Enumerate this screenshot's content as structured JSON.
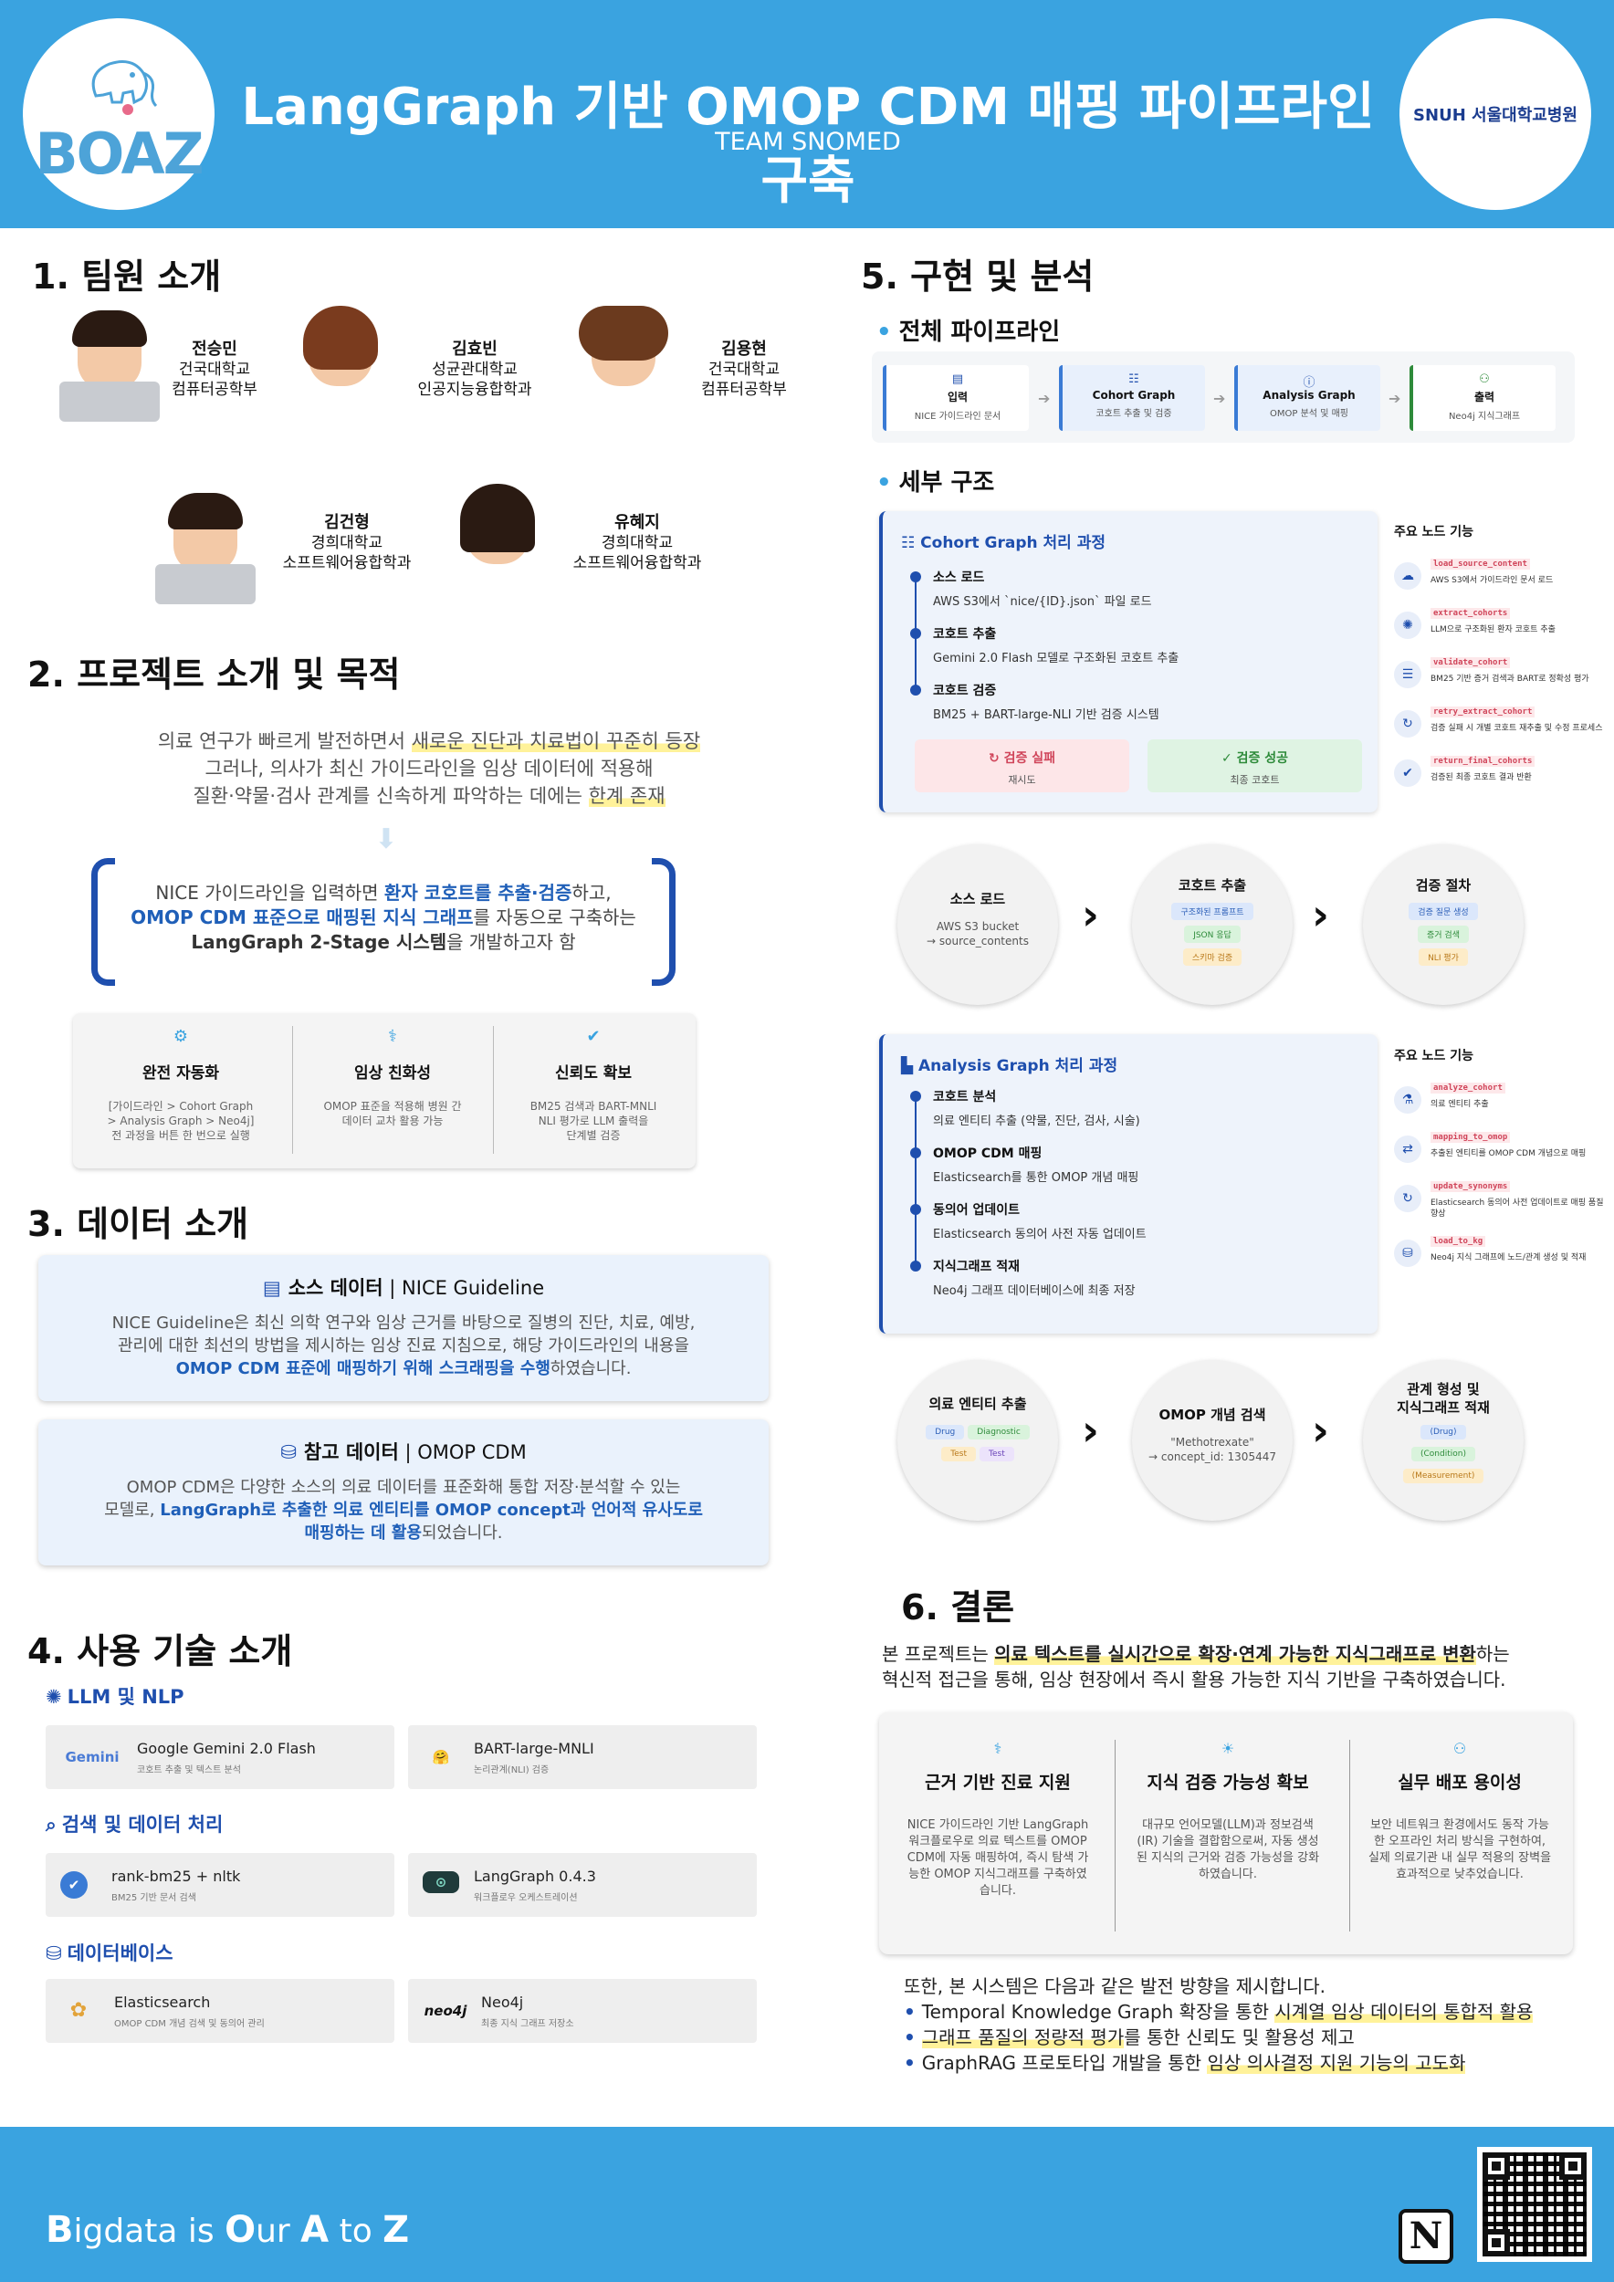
{
  "header": {
    "title": "LangGraph 기반 OMOP CDM 매핑 파이프라인 구축",
    "subtitle": "TEAM SNOMED",
    "logo_left": "BOAZ",
    "logo_right": "SNUH 서울대학교병원"
  },
  "footer": {
    "slogan_b": "B",
    "slogan_1": "igdata is ",
    "slogan_o": "O",
    "slogan_2": "ur ",
    "slogan_a": "A",
    "slogan_3": " to ",
    "slogan_z": "Z",
    "notion_letter": "N"
  },
  "team": {
    "heading": "1. 팀원 소개",
    "members": [
      {
        "name": "전승민",
        "school": "건국대학교",
        "dept": "컴퓨터공학부"
      },
      {
        "name": "김효빈",
        "school": "성균관대학교",
        "dept": "인공지능융합학과"
      },
      {
        "name": "김용현",
        "school": "건국대학교",
        "dept": "컴퓨터공학부"
      },
      {
        "name": "김건형",
        "school": "경희대학교",
        "dept": "소프트웨어융합학과"
      },
      {
        "name": "유혜지",
        "school": "경희대학교",
        "dept": "소프트웨어융합학과"
      }
    ]
  },
  "project": {
    "heading": "2. 프로젝트 소개 및 목적",
    "line1_a": "의료 연구가 빠르게 발전하면서 ",
    "line1_hl": "새로운 진단과 치료법이 꾸준히 등장",
    "line2": "그러나, 의사가 최신 가이드라인을 임상 데이터에 적용해",
    "line3_a": "질환·약물·검사 관계를 신속하게 파악하는 데에는 ",
    "line3_hl": "한계 존재",
    "goal_a": "NICE 가이드라인을 입력하면 ",
    "goal_b": "환자 코호트를 추출·검증",
    "goal_c": "하고,",
    "goal_d": "OMOP CDM 표준으로 매핑된 지식 그래프",
    "goal_e": "를 자동으로 구축하는",
    "goal_f": "LangGraph 2-Stage 시스템",
    "goal_g": "을 개발하고자 함",
    "features": [
      {
        "title": "완전 자동화",
        "desc1": "[가이드라인 > Cohort Graph",
        "desc2": "> Analysis Graph > Neo4j]",
        "desc3": "전 과정을 버튼 한 번으로 실행"
      },
      {
        "title": "임상 친화성",
        "desc1": "OMOP 표준을 적용해 병원 간",
        "desc2": "데이터 교차 활용 가능",
        "desc3": ""
      },
      {
        "title": "신뢰도 확보",
        "desc1": "BM25 검색과 BART-MNLI",
        "desc2": "NLI 평가로 LLM 출력을",
        "desc3": "단계별 검증"
      }
    ]
  },
  "data": {
    "heading": "3. 데이터 소개",
    "source_title": "소스 데이터",
    "source_sub": " | NICE Guideline",
    "source_text1": "NICE Guideline은 최신 의학 연구와 임상 근거를 바탕으로 질병의 진단, 치료, 예방,",
    "source_text2": "관리에 대한 최선의 방법을 제시하는 임상 진료 지침으로, 해당 가이드라인의 내용을",
    "source_text3_b": "OMOP CDM 표준에 매핑하기 위해 스크래핑을 수행",
    "source_text3_c": "하였습니다.",
    "ref_title": "참고 데이터",
    "ref_sub": " | OMOP CDM",
    "ref_text1": "OMOP CDM은 다양한 소스의 의료 데이터를 표준화해 통합 저장·분석할 수 있는",
    "ref_text2_a": "모델로, ",
    "ref_text2_b": "LangGraph로 추출한 의료 엔티티를 OMOP concept과 언어적 유사도로",
    "ref_text3_b": "매핑하는 데 활용",
    "ref_text3_c": "되었습니다."
  },
  "tech": {
    "heading": "4. 사용 기술 소개",
    "groups": [
      {
        "title": "LLM 및 NLP",
        "items": [
          {
            "logo": "Gemini",
            "name": "Google Gemini 2.0 Flash",
            "desc": "코호트 추출 및 텍스트 분석"
          },
          {
            "logo": "🤗",
            "name": "BART-large-MNLI",
            "desc": "논리관계(NLI) 검증"
          }
        ]
      },
      {
        "title": "검색 및 데이터 처리",
        "items": [
          {
            "logo": "✔",
            "name": "rank-bm25 + nltk",
            "desc": "BM25 기반 문서 검색"
          },
          {
            "logo": "⊙",
            "name": "LangGraph 0.4.3",
            "desc": "워크플로우 오케스트레이션"
          }
        ]
      },
      {
        "title": "데이터베이스",
        "items": [
          {
            "logo": "✿",
            "name": "Elasticsearch",
            "desc": "OMOP CDM 개념 검색 및 동의어 관리"
          },
          {
            "logo": "neo4j",
            "name": "Neo4j",
            "desc": "최종 지식 그래프 저장소"
          }
        ]
      }
    ]
  },
  "impl": {
    "heading": "5. 구현 및 분석",
    "pipeline_heading": "전체 파이프라인",
    "pipeline": [
      {
        "title": "입력",
        "desc": "NICE 가이드라인 문서"
      },
      {
        "title": "Cohort Graph",
        "desc": "코호트 추출 및 검증"
      },
      {
        "title": "Analysis Graph",
        "desc": "OMOP 분석 및 매핑"
      },
      {
        "title": "출력",
        "desc": "Neo4j 지식그래프"
      }
    ],
    "detail_heading": "세부 구조",
    "cohort": {
      "title": "Cohort Graph 처리 과정",
      "steps": [
        {
          "title": "소스 로드",
          "desc": "AWS S3에서 `nice/{ID}.json` 파일 로드"
        },
        {
          "title": "코호트 추출",
          "desc": "Gemini 2.0 Flash 모델로 구조화된 코호트 추출"
        },
        {
          "title": "코호트 검증",
          "desc": "BM25 + BART-large-NLI 기반 검증 시스템"
        }
      ],
      "fail_title": "검증 실패",
      "fail_desc": "재시도",
      "success_title": "검증 성공",
      "success_desc": "최종 코호트"
    },
    "cohort_nodes_heading": "주요 노드 기능",
    "cohort_nodes": [
      {
        "code": "load_source_content",
        "desc": "AWS S3에서 가이드라인 문서 로드"
      },
      {
        "code": "extract_cohorts",
        "desc": "LLM으로 구조화된 환자 코호트 추출"
      },
      {
        "code": "validate_cohort",
        "desc": "BM25 기반 증거 검색과 BART로 정확성 평가"
      },
      {
        "code": "retry_extract_cohort",
        "desc": "검증 실패 시 개별 코호트 재추출 및 수정 프로세스"
      },
      {
        "code": "return_final_cohorts",
        "desc": "검증된 최종 코호트 결과 반환"
      }
    ],
    "cohort_circles": [
      {
        "title": "소스 로드",
        "desc1": "AWS S3 bucket",
        "desc2": "→ source_contents"
      },
      {
        "title": "코호트 추출",
        "pills": [
          "구조화된 프롬프트",
          "JSON 응답",
          "스키마 검증"
        ]
      },
      {
        "title": "검증 절차",
        "pills": [
          "검증 질문 생성",
          "증거 검색",
          "NLI 평가"
        ]
      }
    ],
    "analysis": {
      "title": "Analysis Graph 처리 과정",
      "steps": [
        {
          "title": "코호트 분석",
          "desc": "의료 엔티티 추출 (약물, 진단, 검사, 시술)"
        },
        {
          "title": "OMOP CDM 매핑",
          "desc": "Elasticsearch를 통한 OMOP 개념 매핑"
        },
        {
          "title": "동의어 업데이트",
          "desc": "Elasticsearch 동의어 사전 자동 업데이트"
        },
        {
          "title": "지식그래프 적재",
          "desc": "Neo4j 그래프 데이터베이스에 최종 저장"
        }
      ]
    },
    "analysis_nodes_heading": "주요 노드 기능",
    "analysis_nodes": [
      {
        "code": "analyze_cohort",
        "desc": "의료 엔티티 추출"
      },
      {
        "code": "mapping_to_omop",
        "desc": "추출된 엔티티를 OMOP CDM 개념으로 매핑"
      },
      {
        "code": "update_synonyms",
        "desc": "Elasticsearch 동의어 사전 업데이트로 매핑 품질 향상"
      },
      {
        "code": "load_to_kg",
        "desc": "Neo4j 지식 그래프에 노드/관계 생성 및 적재"
      }
    ],
    "analysis_circles": [
      {
        "title": "의료 엔티티 추출",
        "pills": [
          "Drug",
          "Diagnostic",
          "Test",
          "Test"
        ]
      },
      {
        "title": "OMOP 개념 검색",
        "desc1": "\"Methotrexate\"",
        "desc2": "→ concept_id: 1305447"
      },
      {
        "title1": "관계 형성 및",
        "title2": "지식그래프 적재",
        "pills": [
          "(Drug)",
          "(Condition)",
          "(Measurement)"
        ]
      }
    ]
  },
  "conclusion": {
    "heading": "6. 결론",
    "intro_a": "본 프로젝트는 ",
    "intro_b": "의료 텍스트를 실시간으로 확장·연계 가능한 지식그래프로 변환",
    "intro_c": "하는",
    "intro_d": "혁신적 접근을 통해, 임상 현장에서 즉시 활용 가능한 지식 기반을 구축하였습니다.",
    "cards": [
      {
        "title": "근거 기반 진료 지원",
        "desc": "NICE 가이드라인 기반 LangGraph 워크플로우로 의료 텍스트를 OMOP CDM에 자동 매핑하여, 즉시 탐색 가능한 OMOP 지식그래프를 구축하였습니다."
      },
      {
        "title": "지식 검증 가능성 확보",
        "desc": "대규모 언어모델(LLM)과 정보검색(IR) 기술을 결합함으로써, 자동 생성된 지식의 근거와 검증 가능성을 강화하였습니다."
      },
      {
        "title": "실무 배포 용이성",
        "desc": "보안 네트워크 환경에서도 동작 가능한 오프라인 처리 방식을 구현하여, 실제 의료기관 내 실무 적용의 장벽을 효과적으로 낮추었습니다."
      }
    ],
    "future_intro": "또한, 본 시스템은 다음과 같은 발전 방향을 제시합니다.",
    "future": [
      {
        "a": "Temporal Knowledge Graph 확장을 통한 ",
        "b": "시계열 임상 데이터의 통합적 활용",
        "c": ""
      },
      {
        "a": "",
        "b": "그래프 품질의 정량적 평가",
        "c": "를 통한 신뢰도 및 활용성 제고"
      },
      {
        "a": "GraphRAG 프로토타입 개발을 통한 ",
        "b": "임상 의사결정 지원 기능의 고도화",
        "c": ""
      }
    ]
  },
  "colors": {
    "accent": "#3aa3e0",
    "navy": "#1f4fae",
    "highlight": "#fff29a"
  }
}
